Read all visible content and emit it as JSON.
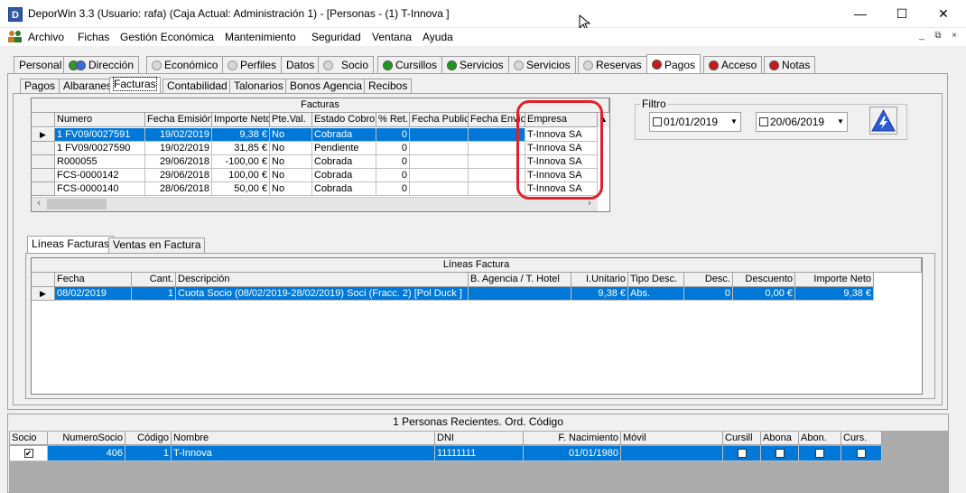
{
  "window": {
    "title": "DeporWin 3.3  (Usuario: rafa)  (Caja Actual: Administración 1) - [Personas - (1) T-Innova  ]",
    "icon": "D"
  },
  "menu": [
    {
      "label": "Archivo"
    },
    {
      "label": "Fichas"
    },
    {
      "label": "Gestión Económica"
    },
    {
      "label": "Mantenimiento"
    },
    {
      "label": "Seguridad"
    },
    {
      "label": "Ventana"
    },
    {
      "label": "Ayuda"
    }
  ],
  "tabs": [
    {
      "label": "Personal"
    },
    {
      "label": "Dirección"
    },
    {
      "label": "Económico"
    },
    {
      "label": "Perfiles"
    },
    {
      "label": "Datos"
    },
    {
      "label": "Socio"
    },
    {
      "label": "Cursillos"
    },
    {
      "label": "Servicios"
    },
    {
      "label": "Servicios"
    },
    {
      "label": "Reservas"
    },
    {
      "label": "Pagos"
    },
    {
      "label": "Acceso"
    },
    {
      "label": "Notas"
    }
  ],
  "subtabs": [
    {
      "label": "Pagos"
    },
    {
      "label": "Albaranes"
    },
    {
      "label": "Facturas"
    },
    {
      "label": "Contabilidad"
    },
    {
      "label": "Talonarios"
    },
    {
      "label": "Bonos Agencia"
    },
    {
      "label": "Recibos"
    }
  ],
  "facturas": {
    "title": "Facturas",
    "columns": [
      "Numero",
      "Fecha Emisión",
      "Importe Neto",
      "Pte.Val.",
      "Estado Cobro",
      "% Ret.",
      "Fecha Public",
      "Fecha Envío",
      "Empresa"
    ],
    "rows": [
      [
        "1 FV09/0027591",
        "19/02/2019",
        "9,38 €",
        "No",
        "Cobrada",
        "0",
        "",
        "",
        "T-Innova SA"
      ],
      [
        "1 FV09/0027590",
        "19/02/2019",
        "31,85 €",
        "No",
        "Pendiente",
        "0",
        "",
        "",
        "T-Innova SA"
      ],
      [
        "R000055",
        "29/06/2018",
        "-100,00 €",
        "No",
        "Cobrada",
        "0",
        "",
        "",
        "T-Innova SA"
      ],
      [
        "FCS-0000142",
        "29/06/2018",
        "100,00 €",
        "No",
        "Cobrada",
        "0",
        "",
        "",
        "T-Innova SA"
      ],
      [
        "FCS-0000140",
        "28/06/2018",
        "50,00 €",
        "No",
        "Cobrada",
        "0",
        "",
        "",
        "T-Innova SA"
      ]
    ]
  },
  "filtro": {
    "label": "Filtro",
    "date_from": "01/01/2019",
    "date_to": "20/06/2019"
  },
  "lower_tabs": [
    {
      "label": "Líneas Facturas"
    },
    {
      "label": "Ventas en Factura"
    }
  ],
  "lineas": {
    "title": "Líneas Factura",
    "columns": [
      "Fecha",
      "Cant.",
      "Descripción",
      "B. Agencia / T. Hotel",
      "I.Unitario",
      "Tipo Desc.",
      "Desc.",
      "Descuento",
      "Importe Neto"
    ],
    "rows": [
      [
        "08/02/2019",
        "1",
        "Cuota Socio (08/02/2019-28/02/2019) Soci (Fracc. 2) [Pol Duck ]",
        "",
        "9,38 €",
        "Abs.",
        "0",
        "0,00 €",
        "9,38 €"
      ]
    ]
  },
  "personas": {
    "title": "1 Personas Recientes. Ord. Código",
    "columns": [
      "Socio",
      "NumeroSocio",
      "Código",
      "Nombre",
      "DNI",
      "F. Nacimiento",
      "Móvil",
      "Cursill",
      "Abona",
      "Abon.",
      "Curs."
    ],
    "rows": [
      {
        "socio": true,
        "numero": "406",
        "codigo": "1",
        "nombre": "T-Innova",
        "dni": "11111111",
        "nacimiento": "01/01/1980",
        "movil": "",
        "cursill": false,
        "abona": false,
        "abon": false,
        "curs": true
      }
    ]
  },
  "colors": {
    "selection": "#0078d7",
    "highlight_circle": "#e0202a"
  }
}
